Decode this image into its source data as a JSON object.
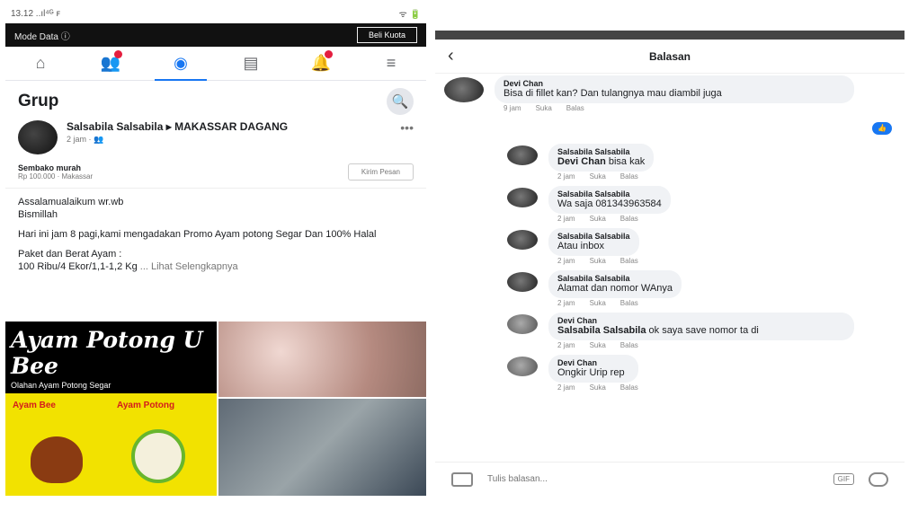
{
  "left": {
    "status_time": "13.12 ..ıl⁴ᴳ ꜰ",
    "status_right": "ᯤ 🔋",
    "data_mode": "Mode Data ⓘ",
    "buy_label": "Beli Kuota",
    "group_title": "Grup",
    "post": {
      "author": "Salsabila Salsabila ▸ MAKASSAR DAGANG",
      "time": "2 jam · 👥",
      "sale_title": "Sembako murah",
      "sale_price": "Rp 100.000 · Makassar",
      "sale_button": "Kirim Pesan",
      "para1": "Assalamualaikum wr.wb\nBismillah",
      "para2": "Hari ini jam 8 pagi,kami mengadakan Promo Ayam potong Segar Dan 100% Halal",
      "para3": "Paket dan Berat Ayam :\n100 Ribu/4 Ekor/1,1-1,2 Kg",
      "see_more": "... Lihat Selengkapnya"
    },
    "collage": {
      "banner": "Ayam Potong U Bee",
      "banner_sub": "Olahan Ayam Potong Segar",
      "label1": "Ayam Bee",
      "label2": "Ayam Potong"
    }
  },
  "right": {
    "title": "Balasan",
    "comments": [
      {
        "name": "Devi Chan",
        "text": "Bisa di fillet kan? Dan tulangnya mau diambil juga",
        "time": "9 jam",
        "like": "Suka",
        "reply": "Balas"
      },
      {
        "name": "Salsabila Salsabila",
        "tag": "Devi Chan",
        "text": "bisa kak",
        "time": "2 jam",
        "like": "Suka",
        "reply": "Balas"
      },
      {
        "name": "Salsabila Salsabila",
        "text": "Wa saja 081343963584",
        "time": "2 jam",
        "like": "Suka",
        "reply": "Balas"
      },
      {
        "name": "Salsabila Salsabila",
        "text": "Atau inbox",
        "time": "2 jam",
        "like": "Suka",
        "reply": "Balas"
      },
      {
        "name": "Salsabila Salsabila",
        "text": "Alamat dan nomor WAnya",
        "time": "2 jam",
        "like": "Suka",
        "reply": "Balas"
      },
      {
        "name": "Devi Chan",
        "tag": "Salsabila Salsabila",
        "text": "ok saya save nomor ta di",
        "time": "2 jam",
        "like": "Suka",
        "reply": "Balas"
      },
      {
        "name": "Devi Chan",
        "text": "Ongkir Urip rep",
        "time": "2 jam",
        "like": "Suka",
        "reply": "Balas"
      }
    ],
    "like_count": "👍",
    "composer_placeholder": "Tulis balasan...",
    "gif_label": "GIF"
  }
}
